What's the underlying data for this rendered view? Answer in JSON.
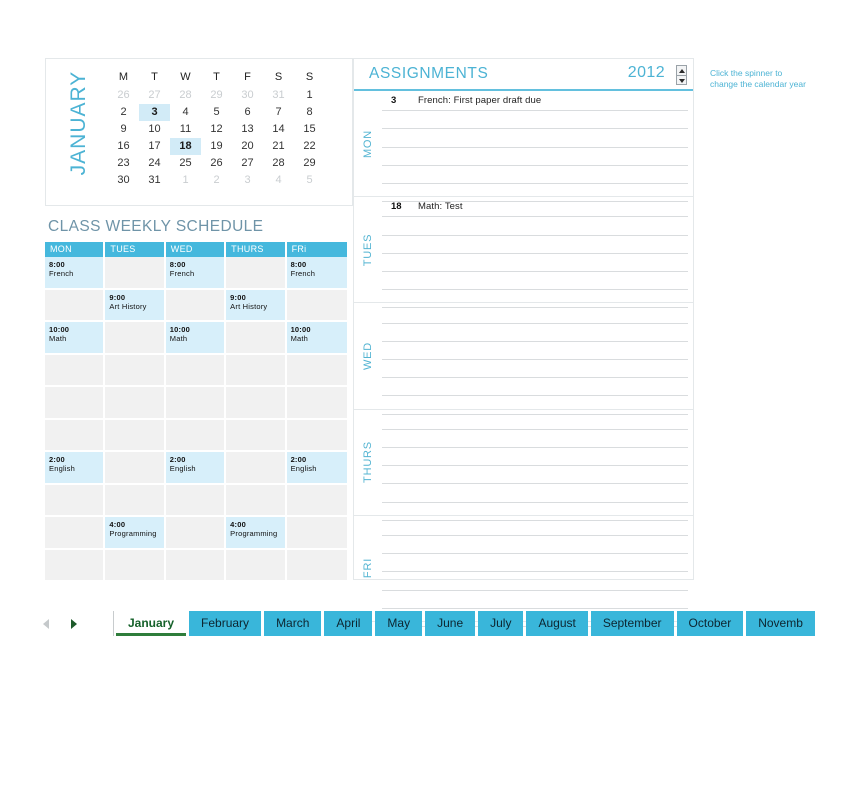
{
  "calendar": {
    "month_label": "JANUARY",
    "dow": [
      "M",
      "T",
      "W",
      "T",
      "F",
      "S",
      "S"
    ],
    "weeks": [
      [
        {
          "d": "26",
          "muted": true
        },
        {
          "d": "27",
          "muted": true
        },
        {
          "d": "28",
          "muted": true
        },
        {
          "d": "29",
          "muted": true
        },
        {
          "d": "30",
          "muted": true
        },
        {
          "d": "31",
          "muted": true
        },
        {
          "d": "1",
          "muted": false
        }
      ],
      [
        {
          "d": "2",
          "muted": false
        },
        {
          "d": "3",
          "muted": false,
          "hl": true
        },
        {
          "d": "4",
          "muted": false
        },
        {
          "d": "5",
          "muted": false
        },
        {
          "d": "6",
          "muted": false
        },
        {
          "d": "7",
          "muted": false
        },
        {
          "d": "8",
          "muted": false
        }
      ],
      [
        {
          "d": "9",
          "muted": false
        },
        {
          "d": "10",
          "muted": false
        },
        {
          "d": "11",
          "muted": false
        },
        {
          "d": "12",
          "muted": false
        },
        {
          "d": "13",
          "muted": false
        },
        {
          "d": "14",
          "muted": false
        },
        {
          "d": "15",
          "muted": false
        }
      ],
      [
        {
          "d": "16",
          "muted": false
        },
        {
          "d": "17",
          "muted": false
        },
        {
          "d": "18",
          "muted": false,
          "hl": true
        },
        {
          "d": "19",
          "muted": false
        },
        {
          "d": "20",
          "muted": false
        },
        {
          "d": "21",
          "muted": false
        },
        {
          "d": "22",
          "muted": false
        }
      ],
      [
        {
          "d": "23",
          "muted": false
        },
        {
          "d": "24",
          "muted": false
        },
        {
          "d": "25",
          "muted": false
        },
        {
          "d": "26",
          "muted": false
        },
        {
          "d": "27",
          "muted": false
        },
        {
          "d": "28",
          "muted": false
        },
        {
          "d": "29",
          "muted": false
        }
      ],
      [
        {
          "d": "30",
          "muted": false
        },
        {
          "d": "31",
          "muted": false
        },
        {
          "d": "1",
          "muted": true
        },
        {
          "d": "2",
          "muted": true
        },
        {
          "d": "3",
          "muted": true
        },
        {
          "d": "4",
          "muted": true
        },
        {
          "d": "5",
          "muted": true
        }
      ]
    ]
  },
  "weekly_schedule": {
    "title": "CLASS WEEKLY SCHEDULE",
    "columns": [
      "MON",
      "TUES",
      "WED",
      "THURS",
      "FRi"
    ],
    "rows": [
      [
        {
          "time": "8:00",
          "subject": "French"
        },
        {},
        {
          "time": "8:00",
          "subject": "French"
        },
        {},
        {
          "time": "8:00",
          "subject": "French"
        }
      ],
      [
        {},
        {
          "time": "9:00",
          "subject": "Art History"
        },
        {},
        {
          "time": "9:00",
          "subject": "Art History"
        },
        {}
      ],
      [
        {
          "time": "10:00",
          "subject": "Math"
        },
        {},
        {
          "time": "10:00",
          "subject": "Math"
        },
        {},
        {
          "time": "10:00",
          "subject": "Math"
        }
      ],
      [
        {},
        {},
        {},
        {},
        {}
      ],
      [
        {},
        {},
        {},
        {},
        {}
      ],
      [
        {},
        {},
        {},
        {},
        {}
      ],
      [
        {
          "time": "2:00",
          "subject": "English"
        },
        {},
        {
          "time": "2:00",
          "subject": "English"
        },
        {},
        {
          "time": "2:00",
          "subject": "English"
        }
      ],
      [
        {},
        {},
        {},
        {},
        {}
      ],
      [
        {},
        {
          "time": "4:00",
          "subject": "Programming"
        },
        {},
        {
          "time": "4:00",
          "subject": "Programming"
        },
        {}
      ],
      [
        {},
        {},
        {},
        {},
        {}
      ]
    ]
  },
  "assignments": {
    "title": "ASSIGNMENTS",
    "year": "2012",
    "days": [
      {
        "label": "MON",
        "lines": [
          {
            "date": "3",
            "text": "French: First paper draft due"
          },
          {},
          {},
          {},
          {},
          {}
        ]
      },
      {
        "label": "TUES",
        "lines": [
          {
            "date": "18",
            "text": "Math: Test"
          },
          {},
          {},
          {},
          {},
          {}
        ]
      },
      {
        "label": "WED",
        "lines": [
          {},
          {},
          {},
          {},
          {},
          {}
        ]
      },
      {
        "label": "THURS",
        "lines": [
          {},
          {},
          {},
          {},
          {},
          {}
        ]
      },
      {
        "label": "FRI",
        "lines": [
          {},
          {},
          {},
          {},
          {},
          {}
        ]
      }
    ]
  },
  "hint": {
    "line1": "Click the spinner to",
    "line2": "change the calendar year"
  },
  "tabs": {
    "items": [
      {
        "label": "January",
        "active": true
      },
      {
        "label": "February",
        "active": false
      },
      {
        "label": "March",
        "active": false
      },
      {
        "label": "April",
        "active": false
      },
      {
        "label": "May",
        "active": false
      },
      {
        "label": "June",
        "active": false
      },
      {
        "label": "July",
        "active": false
      },
      {
        "label": "August",
        "active": false
      },
      {
        "label": "September",
        "active": false
      },
      {
        "label": "October",
        "active": false
      },
      {
        "label": "Novemb",
        "active": false
      }
    ]
  },
  "colors": {
    "accent": "#4cb3d4",
    "header_fill": "#45b8dd",
    "cell_fill": "#d7effa",
    "cell_empty": "#f1f1f1",
    "tab_fill": "#39b6da",
    "active_tab_text": "#15612a"
  }
}
